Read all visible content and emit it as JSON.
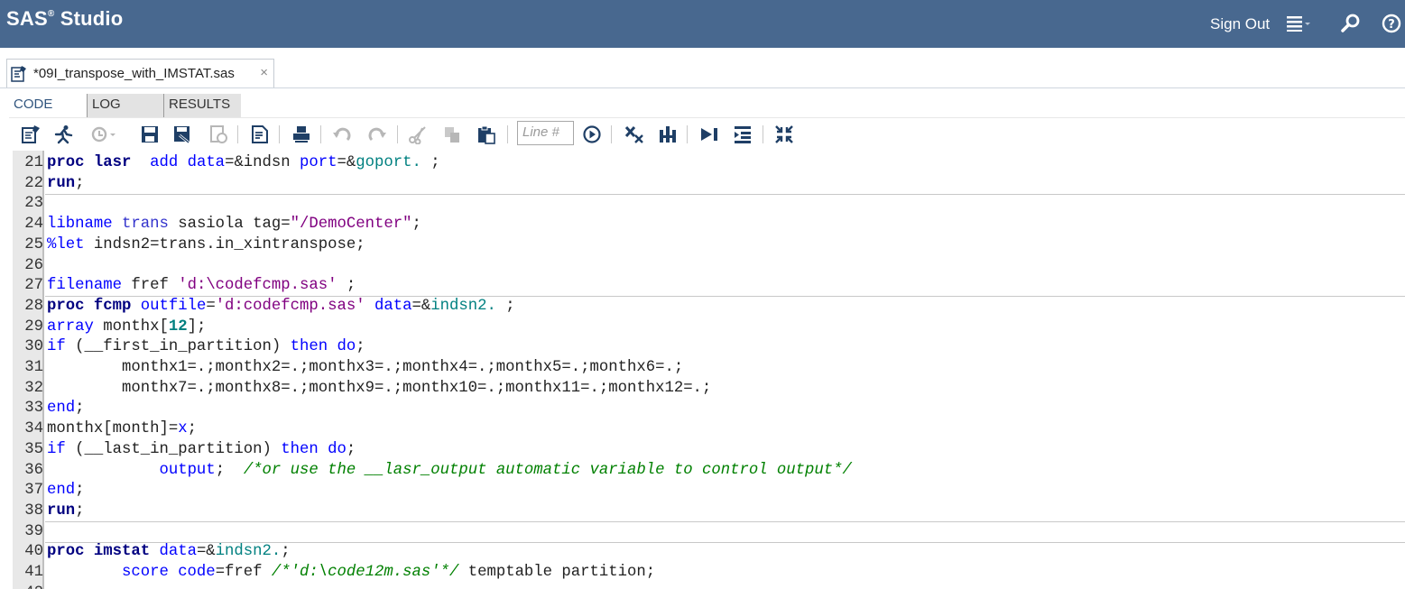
{
  "header": {
    "brand_main": "SAS",
    "brand_reg": "®",
    "brand_suffix": " Studio",
    "sign_out": "Sign Out",
    "accent_color": "#48688f"
  },
  "document_tab": {
    "title": "*09I_transpose_with_IMSTAT.sas",
    "close": "×"
  },
  "subtabs": [
    {
      "label": "CODE",
      "active": true
    },
    {
      "label": "LOG",
      "active": false
    },
    {
      "label": "RESULTS",
      "active": false
    }
  ],
  "toolbar": {
    "line_placeholder": "Line #",
    "icons": [
      "new-options-icon",
      "run-icon",
      "history-icon",
      "save-icon",
      "save-as-icon",
      "open-icon",
      "format-code-icon",
      "print-icon",
      "undo-icon",
      "redo-icon",
      "cut-icon",
      "copy-icon",
      "paste-icon",
      "go-to-line-icon",
      "clear-icon",
      "query-icon",
      "submit-icon",
      "snippets-icon",
      "maximize-icon"
    ]
  },
  "editor": {
    "lines": [
      {
        "n": "21",
        "tokens": [
          [
            "kwb",
            "proc lasr"
          ],
          [
            "",
            "  "
          ],
          [
            "kw",
            "add data"
          ],
          [
            "",
            "="
          ],
          [
            "",
            "&indsn "
          ],
          [
            "kw",
            "port"
          ],
          [
            "",
            "="
          ],
          [
            "",
            "&"
          ],
          [
            "mac",
            "goport."
          ],
          [
            "",
            " ;"
          ]
        ]
      },
      {
        "n": "22",
        "tokens": [
          [
            "kwb",
            "run"
          ],
          [
            "",
            ";"
          ]
        ]
      },
      {
        "n": "23",
        "tokens": []
      },
      {
        "n": "24",
        "tokens": [
          [
            "kw",
            "libname"
          ],
          [
            "",
            " "
          ],
          [
            "fn",
            "trans"
          ],
          [
            "",
            " sasiola tag="
          ],
          [
            "str",
            "\"/DemoCenter\""
          ],
          [
            "",
            ";"
          ]
        ]
      },
      {
        "n": "25",
        "tokens": [
          [
            "kw",
            "%let"
          ],
          [
            "",
            " indsn2=trans.in_xintranspose;"
          ]
        ]
      },
      {
        "n": "26",
        "tokens": []
      },
      {
        "n": "27",
        "tokens": [
          [
            "kw",
            "filename"
          ],
          [
            "",
            " fref "
          ],
          [
            "str",
            "'d:\\codefcmp.sas'"
          ],
          [
            "",
            " ;"
          ]
        ]
      },
      {
        "n": "28",
        "tokens": [
          [
            "kwb",
            "proc fcmp"
          ],
          [
            "",
            " "
          ],
          [
            "kw",
            "outfile"
          ],
          [
            "",
            "="
          ],
          [
            "str",
            "'d:codefcmp.sas'"
          ],
          [
            "",
            " "
          ],
          [
            "kw",
            "data"
          ],
          [
            "",
            "=&"
          ],
          [
            "mac",
            "indsn2."
          ],
          [
            "",
            " ;"
          ]
        ]
      },
      {
        "n": "29",
        "tokens": [
          [
            "kw",
            "array"
          ],
          [
            "",
            " monthx["
          ],
          [
            "num",
            "12"
          ],
          [
            "",
            "];"
          ]
        ]
      },
      {
        "n": "30",
        "tokens": [
          [
            "kw",
            "if"
          ],
          [
            "",
            " (__first_in_partition) "
          ],
          [
            "kw",
            "then do"
          ],
          [
            "",
            ";"
          ]
        ]
      },
      {
        "n": "31",
        "tokens": [
          [
            "",
            "        monthx1=.;monthx2=.;monthx3=.;monthx4=.;monthx5=.;monthx6=.;"
          ]
        ]
      },
      {
        "n": "32",
        "tokens": [
          [
            "",
            "        monthx7=.;monthx8=.;monthx9=.;monthx10=.;monthx11=.;monthx12=.;"
          ]
        ]
      },
      {
        "n": "33",
        "tokens": [
          [
            "kw",
            "end"
          ],
          [
            "",
            ";"
          ]
        ]
      },
      {
        "n": "34",
        "tokens": [
          [
            "",
            "monthx[month]="
          ],
          [
            "kw",
            "x"
          ],
          [
            "",
            ";"
          ]
        ]
      },
      {
        "n": "35",
        "tokens": [
          [
            "kw",
            "if"
          ],
          [
            "",
            " (__last_in_partition) "
          ],
          [
            "kw",
            "then do"
          ],
          [
            "",
            ";"
          ]
        ]
      },
      {
        "n": "36",
        "tokens": [
          [
            "",
            "            "
          ],
          [
            "kw",
            "output"
          ],
          [
            "",
            ";  "
          ],
          [
            "cm",
            "/*or use the __lasr_output automatic variable to control output*/"
          ]
        ]
      },
      {
        "n": "37",
        "tokens": [
          [
            "kw",
            "end"
          ],
          [
            "",
            ";"
          ]
        ]
      },
      {
        "n": "38",
        "tokens": [
          [
            "kwb",
            "run"
          ],
          [
            "",
            ";"
          ]
        ]
      },
      {
        "n": "39",
        "tokens": []
      },
      {
        "n": "40",
        "tokens": [
          [
            "kwb",
            "proc imstat"
          ],
          [
            "",
            " "
          ],
          [
            "kw",
            "data"
          ],
          [
            "",
            "=&"
          ],
          [
            "mac",
            "indsn2."
          ],
          [
            "",
            ";"
          ]
        ]
      },
      {
        "n": "41",
        "tokens": [
          [
            "",
            "        "
          ],
          [
            "kw",
            "score code"
          ],
          [
            "",
            "=fref "
          ],
          [
            "cm",
            "/*'d:\\code12m.sas'*/"
          ],
          [
            "",
            " temptable partition;"
          ]
        ]
      },
      {
        "n": "42",
        "tokens": []
      }
    ],
    "section_breaks_after": [
      "22",
      "27",
      "38",
      "39"
    ]
  }
}
